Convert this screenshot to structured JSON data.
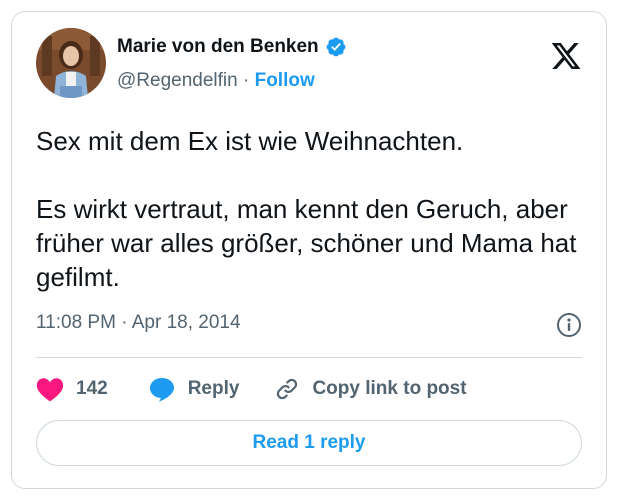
{
  "author": {
    "name": "Marie von den Benken",
    "handle": "@Regendelfin",
    "separator": "·",
    "follow_label": "Follow",
    "verified": true,
    "avatar_icon": "profile-photo",
    "verified_icon": "verified-badge-icon"
  },
  "brand": {
    "logo_icon": "x-logo-icon"
  },
  "tweet": {
    "paragraphs": [
      "Sex mit dem Ex ist wie Weihnachten.",
      "Es wirkt vertraut, man kennt den Geruch, aber früher war alles größer, schöner und Mama hat gefilmt."
    ],
    "timestamp": "11:08 PM · Apr 18, 2014",
    "info_icon": "info-icon"
  },
  "actions": {
    "like_count": "142",
    "reply_label": "Reply",
    "copy_link_label": "Copy link to post",
    "like_icon": "heart-icon",
    "reply_icon": "reply-bubble-icon",
    "copy_icon": "link-icon"
  },
  "footer": {
    "read_replies_label": "Read 1 reply"
  },
  "colors": {
    "accent": "#1d9bf0",
    "like": "#f91880",
    "text": "#0f1419",
    "secondary_text": "#536471",
    "border": "#cfd9de"
  }
}
